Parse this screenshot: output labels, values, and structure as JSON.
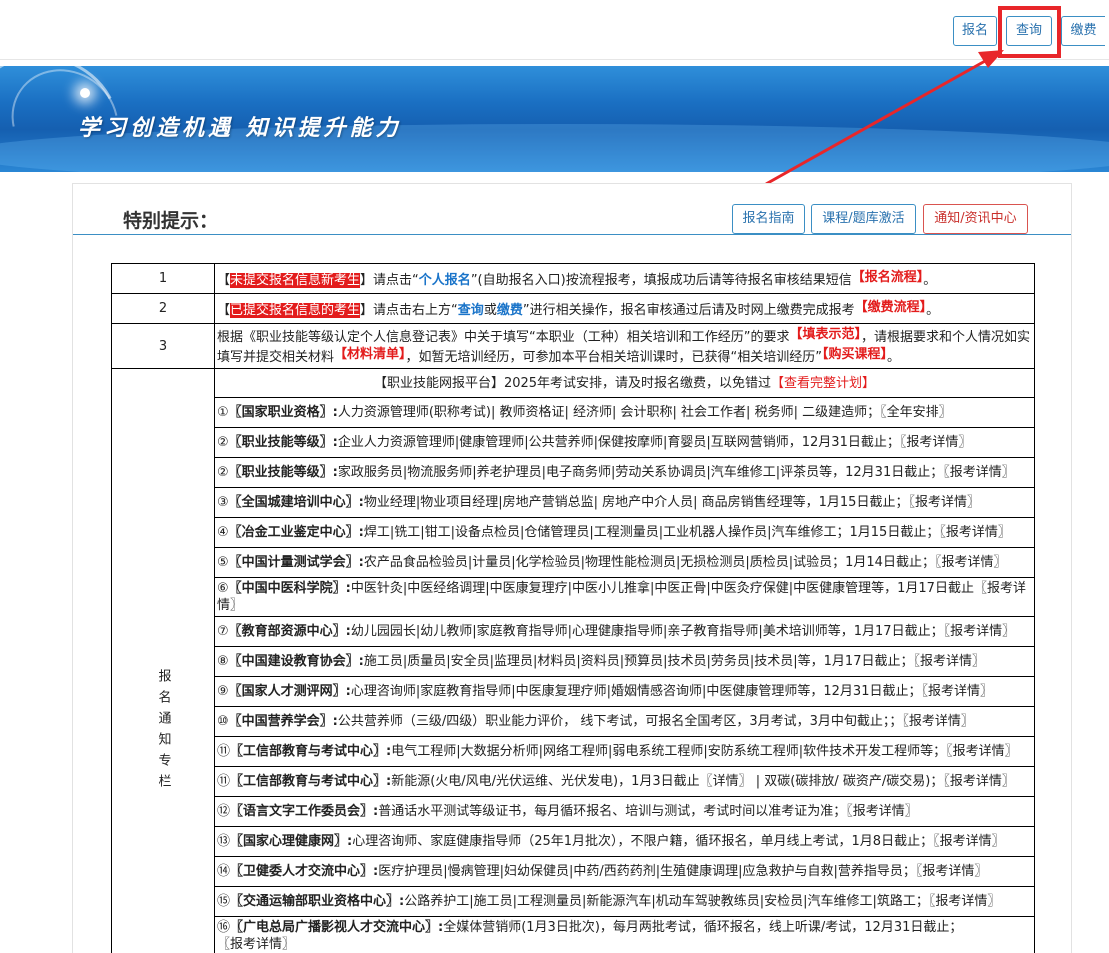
{
  "topbar": {
    "signup": "报名",
    "query": "查询",
    "pay": "缴费"
  },
  "banner": {
    "slogan": "学习创造机遇  知识提升能力"
  },
  "panel": {
    "title": "特别提示：",
    "guide_btn": "报名指南",
    "activate_btn": "课程/题库激活",
    "notice_btn": "通知/资讯中心"
  },
  "notes": [
    {
      "num": "1",
      "tag": "未提交报名信息新考生",
      "t1": "请点击“",
      "link": "个人报名",
      "t2": "”(自助报名入口)按流程报考，填报成功后请等待报名审核结果短信",
      "badge": "【报名流程】",
      "end": "。"
    },
    {
      "num": "2",
      "tag": "已提交报名信息的考生",
      "t1": "请点击右上方“",
      "link1": "查询",
      "or": "或",
      "link2": "缴费",
      "t2": "”进行相关操作，报名审核通过后请及时网上缴费完成报考",
      "badge": "【缴费流程】",
      "end": "。"
    },
    {
      "num": "3",
      "t1": "根据《职业技能等级认定个人信息登记表》中关于填写“本职业（工种）相关培训和工作经历”的要求",
      "badge1": "【填表示范】",
      "t2": "，请根据要求和个人情况如实填写并提交相关材料",
      "badge2": "【材料清单】",
      "t3": "，如暂无培训经历，可参加本平台相关培训课时，已获得“相关培训经历”",
      "badge3": "【购买课程】",
      "end": "。"
    }
  ],
  "side_label": "报名通知专栏",
  "schedule": {
    "intro": "【职业技能网报平台】2025年考试安排，请及时报名缴费，以免错过",
    "link": "【查看完整计划】"
  },
  "items": [
    {
      "num": "①",
      "org": "〖国家职业资格〗:",
      "text": "人力资源管理师(职称考试)| 教师资格证| 经济师| 会计职称| 社会工作者|  税务师| 二级建造师；",
      "detail": "〖全年安排〗"
    },
    {
      "num": "②",
      "org": "〖职业技能等级〗:",
      "text": "企业人力资源管理师|健康管理师|公共营养师|保健按摩师|育婴员|互联网营销师，12月31日截止；",
      "detail": "〖报考详情〗"
    },
    {
      "num": "②",
      "org": "〖职业技能等级〗:",
      "text": "家政服务员|物流服务师|养老护理员|电子商务师|劳动关系协调员|汽车维修工|评茶员等，12月31日截止；",
      "detail": "〖报考详情〗"
    },
    {
      "num": "③",
      "org": "〖全国城建培训中心〗:",
      "text": "物业经理|物业项目经理|房地产营销总监| 房地产中介人员| 商品房销售经理等，1月15日截止；",
      "detail": "〖报考详情〗"
    },
    {
      "num": "④",
      "org": "〖冶金工业鉴定中心〗:",
      "text": "焊工|铣工|钳工|设备点检员|仓储管理员|工程测量员|工业机器人操作员|汽车维修工；1月15日截止；",
      "detail": "〖报考详情〗"
    },
    {
      "num": "⑤",
      "org": "〖中国计量测试学会〗:",
      "text": "农产品食品检验员|计量员|化学检验员|物理性能检测员|无损检测员|质检员|试验员；1月14日截止；",
      "detail": "〖报考详情〗"
    },
    {
      "num": "⑥",
      "org": "〖中国中医科学院〗:",
      "text": "中医针灸|中医经络调理|中医康复理疗|中医小儿推拿|中医正骨|中医灸疗保健|中医健康管理等，1月17日截止",
      "detail": "〖报考详情〗"
    },
    {
      "num": "⑦",
      "org": "〖教育部资源中心〗:",
      "text": "幼儿园园长|幼儿教师|家庭教育指导师|心理健康指导师|亲子教育指导师|美术培训师等，1月17日截止；",
      "detail": "〖报考详情〗"
    },
    {
      "num": "⑧",
      "org": "〖中国建设教育协会〗:",
      "text": "施工员|质量员|安全员|监理员|材料员|资料员|预算员|技术员|劳务员|技术员|等，1月17日截止；",
      "detail": "〖报考详情〗"
    },
    {
      "num": "⑨",
      "org": "〖国家人才测评网〗:",
      "text": "心理咨询师|家庭教育指导师|中医康复理疗师|婚姻情感咨询师|中医健康管理师等，12月31日截止；",
      "detail": "〖报考详情〗"
    },
    {
      "num": "⑩",
      "org": "〖中国营养学会〗:",
      "text": "公共营养师（三级/四级）职业能力评价， 线下考试，可报名全国考区，3月考试，3月中旬截止；；",
      "detail": "〖报考详情〗"
    },
    {
      "num": "⑪",
      "org": "〖工信部教育与考试中心〗:",
      "text": "电气工程师|大数据分析师|网络工程师|弱电系统工程师|安防系统工程师|软件技术开发工程师等；",
      "detail": "〖报考详情〗"
    },
    {
      "num": "⑪",
      "org": "〖工信部教育与考试中心〗:",
      "text": "新能源(火电/风电/光伏运维、光伏发电)，1月3日截止〖详情〗 | 双碳(碳排放/ 碳资产/碳交易)；",
      "detail": "〖报考详情〗"
    },
    {
      "num": "⑫",
      "org": "〖语言文字工作委员会〗:",
      "text": "普通话水平测试等级证书，每月循环报名、培训与测试，考试时间以准考证为准；",
      "detail": "〖报考详情〗"
    },
    {
      "num": "⑬",
      "org": "〖国家心理健康网〗:",
      "text": "心理咨询师、家庭健康指导师（25年1月批次），不限户籍，循环报名，单月线上考试，1月8日截止；",
      "detail": "〖报考详情〗"
    },
    {
      "num": "⑭",
      "org": "〖卫健委人才交流中心〗:",
      "text": "医疗护理员|慢病管理|妇幼保健员|中药/西药药剂|生殖健康调理|应急救护与自救|营养指导员；",
      "detail": "〖报考详情〗"
    },
    {
      "num": "⑮",
      "org": "〖交通运输部职业资格中心〗:",
      "text": "公路养护工|施工员|工程测量员|新能源汽车|机动车驾驶教练员|安检员|汽车维修工|筑路工；",
      "detail": "〖报考详情〗"
    },
    {
      "num": "⑯",
      "org": "〖广电总局广播影视人才交流中心〗:",
      "text": "全媒体营销师(1月3日批次)，每月两批考试，循环报名，线上听课/考试，12月31日截止；",
      "detail": "〖报考详情〗"
    }
  ]
}
